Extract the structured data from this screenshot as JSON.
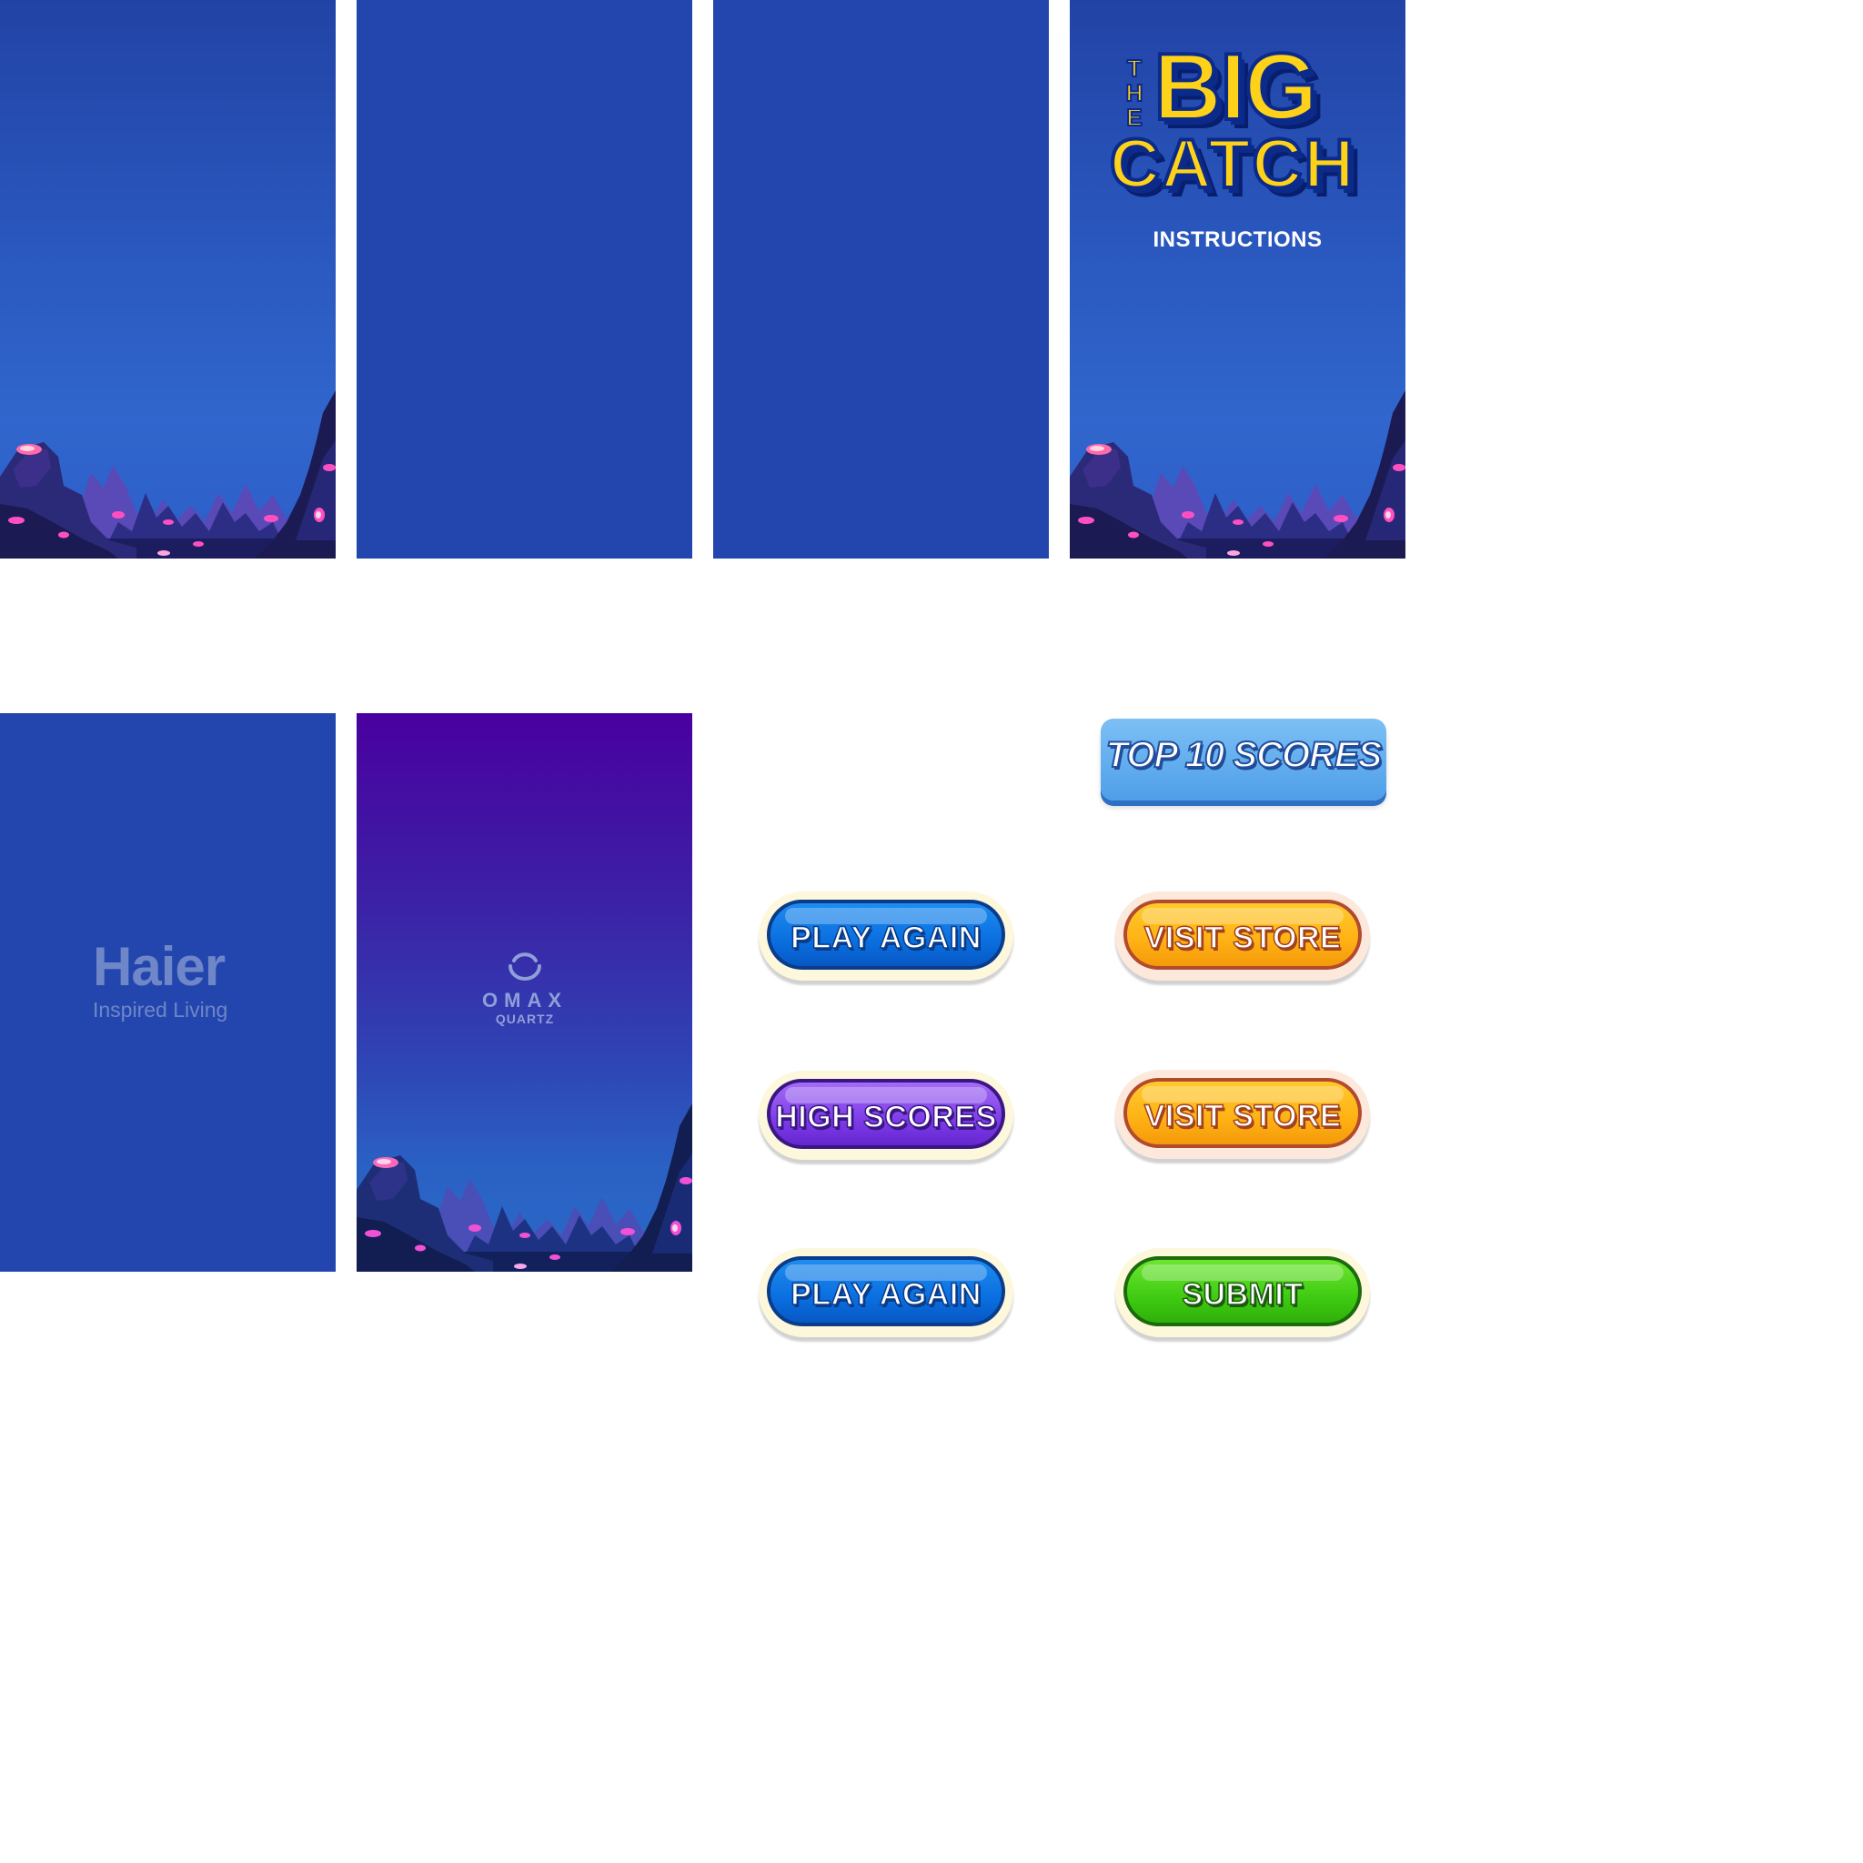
{
  "logo": {
    "the": [
      "T",
      "H",
      "E"
    ],
    "big": "BIG",
    "catch": "CATCH"
  },
  "labels": {
    "instructions": "INSTRUCTIONS",
    "top10": "TOP 10 SCORES"
  },
  "brands": {
    "haier_name": "Haier",
    "haier_tag": "Inspired Living",
    "omax_name": "OMAX",
    "omax_sub": "QUARTZ"
  },
  "buttons": {
    "play_again_1": "PLAY AGAIN",
    "high_scores": "HIGH SCORES",
    "play_again_2": "PLAY AGAIN",
    "visit_store_1": "VISIT STORE",
    "visit_store_2": "VISIT STORE",
    "submit": "SUBMIT"
  },
  "colors": {
    "panel_blue": "#2246ad",
    "button_blue": "#0a6fe0",
    "button_purple": "#7d3ce8",
    "button_orange": "#ffb114",
    "button_green": "#3fcb12",
    "logo_yellow": "#ffd21a"
  }
}
